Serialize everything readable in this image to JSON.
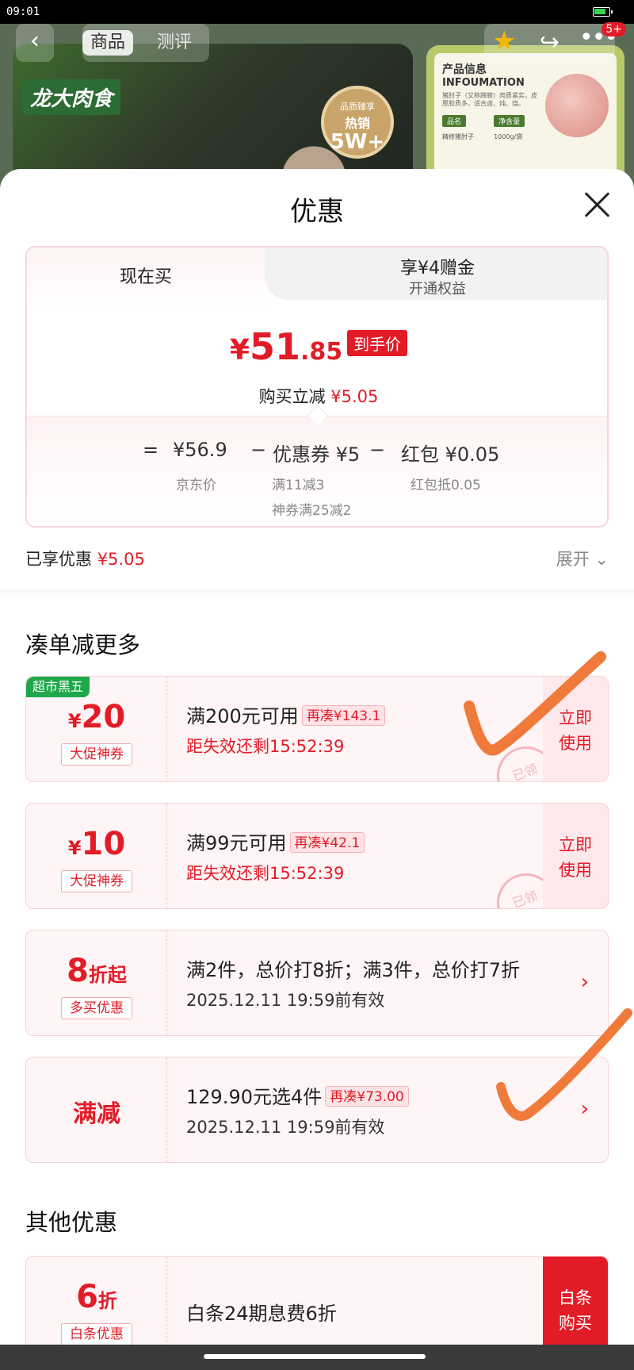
{
  "status_bar": {
    "time": "09:01"
  },
  "background": {
    "nav": {
      "tab_active": "商品",
      "tab_inactive": "测评",
      "more_count": "5+"
    },
    "brand": "龙大肉食",
    "badge": {
      "top": "品质臻享",
      "mid": "热销",
      "big": "5W+"
    },
    "info": {
      "title": "产品信息",
      "subtitle": "INFOUMATION",
      "desc": "猪肘子（又称蹄膀）肉质紧实，皮厚胶质多，适合卤、炖、烧。",
      "tag1": "品名",
      "tag2": "净含量",
      "val1": "精修猪肘子",
      "val2": "1000g/袋",
      "pack": "龙大肉食"
    }
  },
  "sheet": {
    "title": "优惠",
    "price_card": {
      "tab_now": "现在买",
      "tab_right_line1": "享¥4赠金",
      "tab_right_line2": "开通权益",
      "final_yen": "¥",
      "final_int": "51",
      "final_dec": ".85",
      "final_tag": "到手价",
      "reduce_label": "购买立减",
      "reduce_amount": "¥5.05",
      "breakdown": {
        "eq": "=",
        "jd_price": "¥56.9",
        "minus1": "−",
        "coupon": "优惠券 ¥5",
        "minus2": "−",
        "hongbao": "红包 ¥0.05",
        "jd_price_label": "京东价",
        "coupon_sub1": "满11减3",
        "coupon_sub2": "神券满25减2",
        "hongbao_sub": "红包抵0.05"
      }
    },
    "enjoyed_label": "已享优惠",
    "enjoyed_amount": "¥5.05",
    "expand_label": "展开",
    "section_more": "凑单减更多",
    "section_other": "其他优惠",
    "coupons": [
      {
        "flag": "超市黑五",
        "yen": "¥",
        "amount": "20",
        "type": "大促神券",
        "main": "满200元可用",
        "need": "再凑¥143.1",
        "sub": "距失效还剩15:52:39",
        "use_line1": "立即",
        "use_line2": "使用",
        "stamp": "已领"
      },
      {
        "yen": "¥",
        "amount": "10",
        "type": "大促神券",
        "main": "满99元可用",
        "need": "再凑¥42.1",
        "sub": "距失效还剩15:52:39",
        "use_line1": "立即",
        "use_line2": "使用",
        "stamp": "已领"
      },
      {
        "amount": "8",
        "unit": "折起",
        "type": "多买优惠",
        "main": "满2件，总价打8折；满3件，总价打7折",
        "sub": "2025.12.11 19:59前有效",
        "arrow": "›"
      },
      {
        "big": "满减",
        "main": "129.90元选4件",
        "need": "再凑¥73.00",
        "sub": "2025.12.11 19:59前有效",
        "arrow": "›"
      }
    ],
    "other": {
      "amount": "6",
      "unit": "折",
      "type": "白条优惠",
      "main": "白条24期息费6折",
      "buy_line1": "白条",
      "buy_line2": "购买"
    }
  },
  "colors": {
    "accent": "#e21c27",
    "annotation": "#f07a3a",
    "flag_green": "#1fa84a"
  }
}
